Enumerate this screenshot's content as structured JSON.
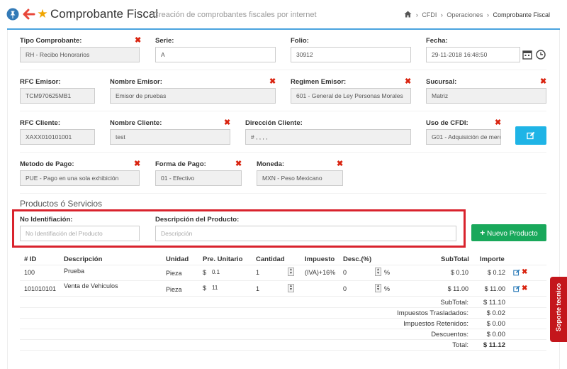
{
  "header": {
    "title": "Comprobante Fiscal",
    "subtitle": "Creación de comprobantes fiscales por internet",
    "breadcrumb": [
      "CFDI",
      "Operaciones",
      "Comprobante Fiscal"
    ],
    "icons": [
      "pin-icon",
      "back-arrow-icon",
      "star-icon",
      "home-icon"
    ]
  },
  "form": {
    "tipo_comprobante": {
      "label": "Tipo Comprobante:",
      "value": "RH - Recibo Honorarios"
    },
    "serie": {
      "label": "Serie:",
      "value": "A"
    },
    "folio": {
      "label": "Folio:",
      "value": "30912"
    },
    "fecha": {
      "label": "Fecha:",
      "value": "29-11-2018 16:48:50"
    },
    "rfc_emisor": {
      "label": "RFC Emisor:",
      "value": "TCM970625MB1"
    },
    "nombre_emisor": {
      "label": "Nombre Emisor:",
      "value": "Emisor de pruebas"
    },
    "regimen_emisor": {
      "label": "Regimen Emisor:",
      "value": "601 - General de Ley Personas Morales"
    },
    "sucursal": {
      "label": "Sucursal:",
      "value": "Matriz"
    },
    "rfc_cliente": {
      "label": "RFC Cliente:",
      "value": "XAXX010101001"
    },
    "nombre_cliente": {
      "label": "Nombre Cliente:",
      "value": "test"
    },
    "direccion_cliente": {
      "label": "Dirección Cliente:",
      "value": "# , , , ,"
    },
    "uso_cfdi": {
      "label": "Uso de CFDI:",
      "value": "G01 - Adquisición de merca"
    },
    "metodo_pago": {
      "label": "Metodo de Pago:",
      "value": "PUE - Pago en una sola exhibición"
    },
    "forma_pago": {
      "label": "Forma de Pago:",
      "value": "01 - Efectivo"
    },
    "moneda": {
      "label": "Moneda:",
      "value": "MXN - Peso Mexicano"
    }
  },
  "products": {
    "section_title": "Productos ó Servicios",
    "id_label": "No Identifiación:",
    "id_placeholder": "No Identifiación del Producto",
    "desc_label": "Descripción del Producto:",
    "desc_placeholder": "Descripción",
    "new_button": "Nuevo Producto"
  },
  "table": {
    "headers": [
      "# ID",
      "Descripción",
      "Unidad",
      "Pre. Unitario",
      "Cantidad",
      "Impuesto",
      "Desc.(%)",
      "SubTotal",
      "Importe"
    ],
    "rows": [
      {
        "id": "100",
        "descripcion": "Prueba",
        "unidad": "Pieza",
        "currency": "$",
        "precio": "0.1",
        "cantidad": "1",
        "impuesto": "(IVA)+16%",
        "descuento": "0",
        "pct": "%",
        "subtotal": "$ 0.10",
        "importe": "$ 0.12"
      },
      {
        "id": "101010101",
        "descripcion": "Venta de Vehiculos",
        "unidad": "Pieza",
        "currency": "$",
        "precio": "11",
        "cantidad": "1",
        "impuesto": "",
        "descuento": "0",
        "pct": "%",
        "subtotal": "$ 11.00",
        "importe": "$ 11.00"
      }
    ]
  },
  "totals": {
    "subtotal_label": "SubTotal:",
    "subtotal": "$ 11.10",
    "trasladados_label": "Impuestos Trasladados:",
    "trasladados": "$ 0.02",
    "retenidos_label": "Impuestos Retenidos:",
    "retenidos": "$ 0.00",
    "descuentos_label": "Descuentos:",
    "descuentos": "$ 0.00",
    "total_label": "Total:",
    "total": "$ 11.12"
  },
  "support": {
    "label": "Soporte tecnico"
  },
  "colors": {
    "accent": "#4aa3df",
    "required": "#d9230f",
    "success": "#19a85b",
    "info": "#1fb4e6",
    "highlight": "#d9232d",
    "support": "#c4161c"
  }
}
